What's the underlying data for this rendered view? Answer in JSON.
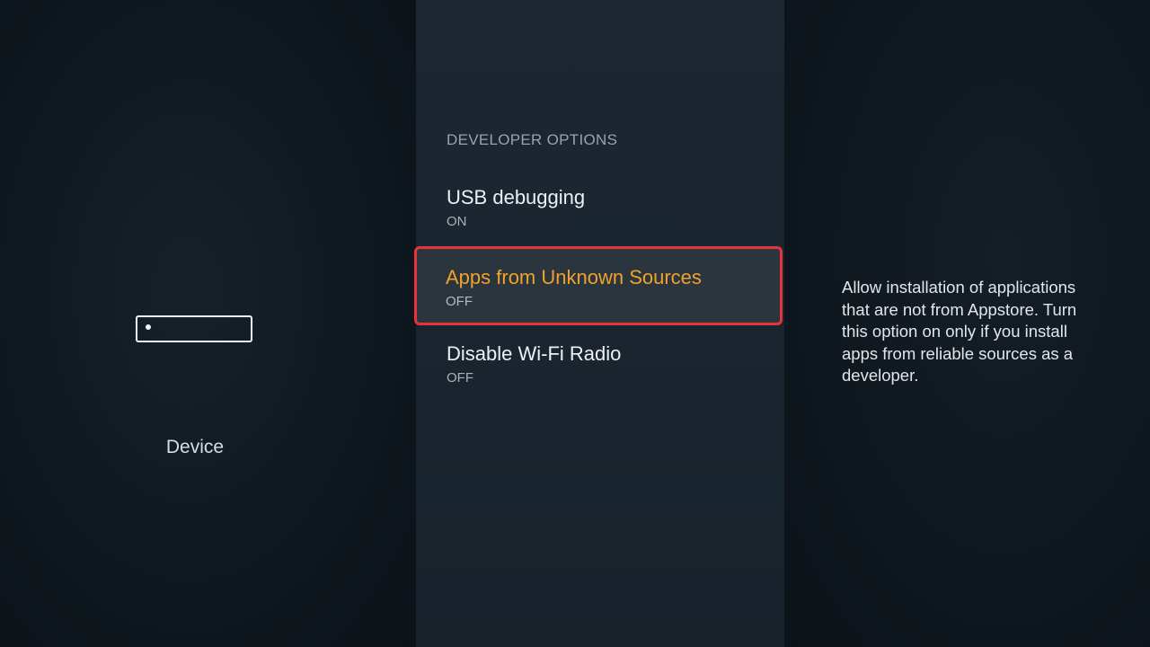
{
  "sidebar": {
    "icon": "fire-tv-device-icon",
    "label": "Device"
  },
  "developer_options": {
    "header": "DEVELOPER OPTIONS",
    "items": [
      {
        "title": "USB debugging",
        "value": "ON",
        "selected": false
      },
      {
        "title": "Apps from Unknown Sources",
        "value": "OFF",
        "selected": true
      },
      {
        "title": "Disable Wi-Fi Radio",
        "value": "OFF",
        "selected": false
      }
    ]
  },
  "description": {
    "text": "Allow installation of applications that are not from Appstore. Turn this option on only if you install apps from reliable sources as a developer."
  },
  "colors": {
    "selected_text": "#f0a22c",
    "highlight_border": "#e8333c",
    "background": "#0f171e"
  }
}
